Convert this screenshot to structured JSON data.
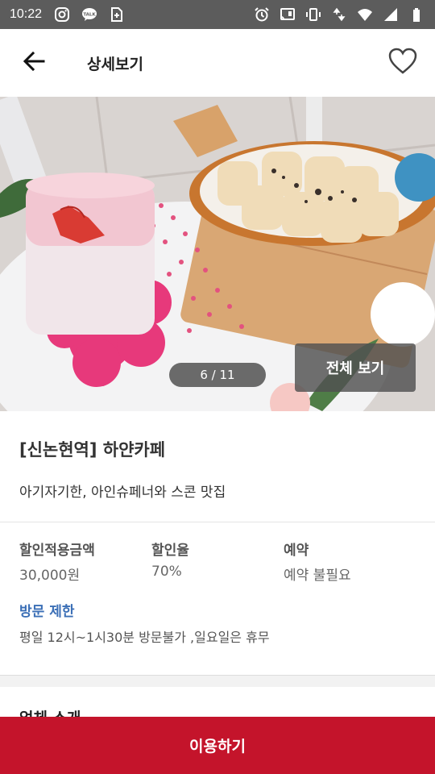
{
  "status_bar": {
    "time": "10:22",
    "left_icons": [
      "instagram-icon",
      "kakaotalk-icon",
      "sim-add-icon"
    ],
    "talk_label": "TALK",
    "right_icons": [
      "alarm-icon",
      "cast-icon",
      "vibrate-icon",
      "data-arrows-icon",
      "wifi-icon",
      "signal-icon",
      "battery-icon"
    ]
  },
  "app_bar": {
    "title": "상세보기",
    "back_icon": "arrow-left-icon",
    "favorite_icon": "heart-outline-icon"
  },
  "gallery": {
    "counter": "6 / 11",
    "view_all_label": "전체 보기"
  },
  "store": {
    "name": "[신논현역] 하얀카페",
    "description": "아기자기한, 아인슈페너와 스콘 맛집"
  },
  "details": {
    "columns": [
      {
        "label": "할인적용금액",
        "value": "30,000원"
      },
      {
        "label": "할인율",
        "value": "70%"
      },
      {
        "label": "예약",
        "value": "예약 불필요"
      }
    ],
    "restriction_label": "방문 제한",
    "restriction_value": "평일 12시~1시30분 방문불가 ,일요일은 휴무"
  },
  "next_section": {
    "heading": "업체 소개"
  },
  "cta": {
    "label": "이용하기"
  },
  "colors": {
    "status_bar": "#5c5c5c",
    "accent_red": "#c4142b",
    "link_blue": "#3b6fb6"
  }
}
